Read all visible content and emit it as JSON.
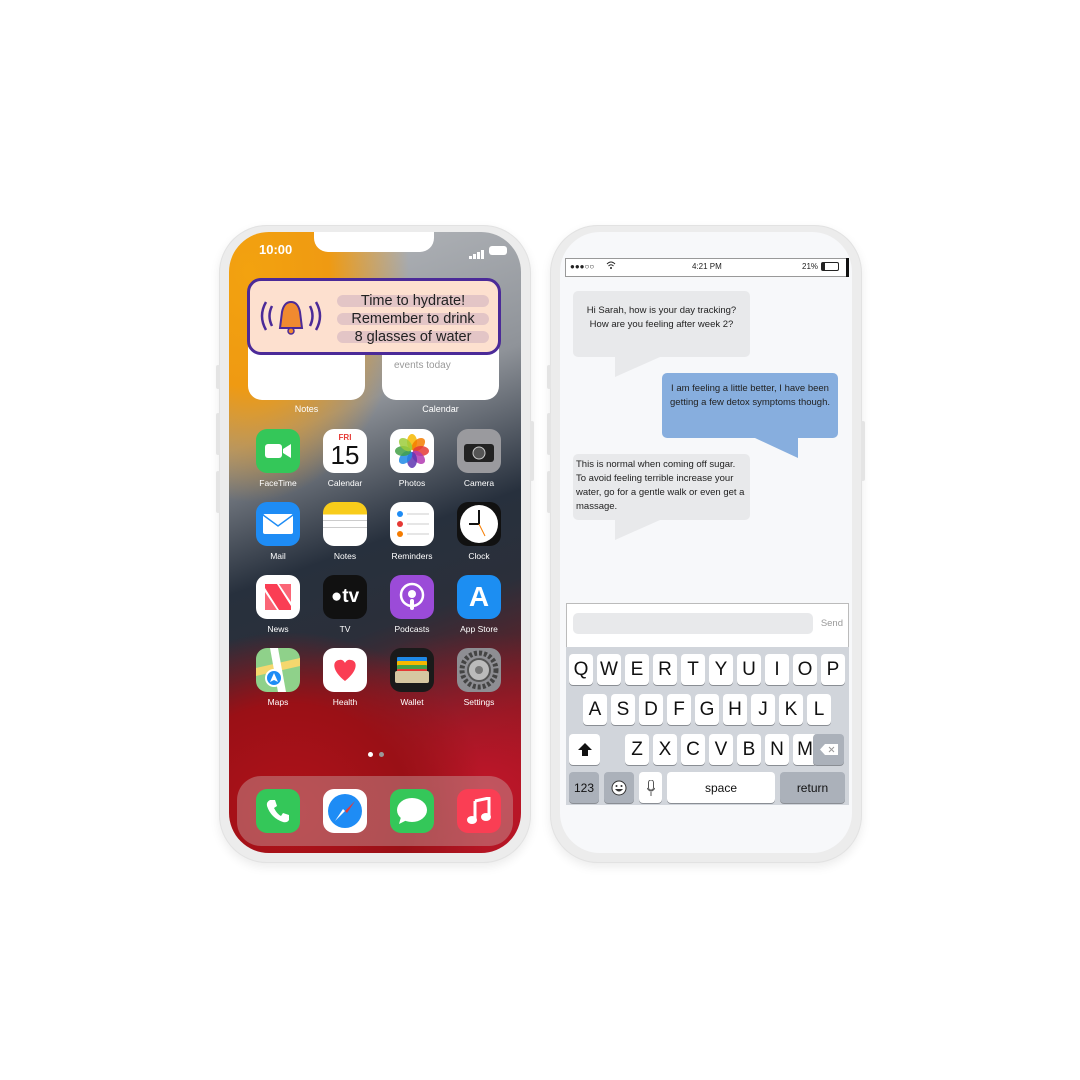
{
  "home_phone": {
    "status_time": "10:00",
    "notification": {
      "icon": "bell-ringing-icon",
      "lines": [
        "Time to hydrate!",
        "Remember to drink",
        "8 glasses of water"
      ],
      "border_color": "#4b2a98",
      "bell_color": "#f08a30",
      "background": "#fde0cf"
    },
    "widgets": [
      {
        "label": "Notes",
        "text": ""
      },
      {
        "label": "Calendar",
        "text": "events today"
      }
    ],
    "apps": [
      {
        "label": "FaceTime",
        "icon": "video-camera-icon",
        "color": "#34c759"
      },
      {
        "label": "Calendar",
        "icon": "calendar-icon",
        "color": "#ffffff",
        "day": "FRI",
        "date": "15"
      },
      {
        "label": "Photos",
        "icon": "photos-flower-icon",
        "color": "#ffffff"
      },
      {
        "label": "Camera",
        "icon": "camera-icon",
        "color": "#9a9a9e"
      },
      {
        "label": "Mail",
        "icon": "envelope-icon",
        "color": "#1e8cf5"
      },
      {
        "label": "Notes",
        "icon": "notepad-icon",
        "color": "#ffffff"
      },
      {
        "label": "Reminders",
        "icon": "list-icon",
        "color": "#ffffff"
      },
      {
        "label": "Clock",
        "icon": "clock-icon",
        "color": "#111111"
      },
      {
        "label": "News",
        "icon": "news-icon",
        "color": "#ffffff"
      },
      {
        "label": "TV",
        "icon": "apple-tv-icon",
        "color": "#111111",
        "glyph": "tv"
      },
      {
        "label": "Podcasts",
        "icon": "podcast-icon",
        "color": "#9b4bd8"
      },
      {
        "label": "App Store",
        "icon": "app-store-icon",
        "color": "#1c8ef2",
        "glyph": "A"
      },
      {
        "label": "Maps",
        "icon": "map-icon",
        "color": "#8fd18a"
      },
      {
        "label": "Health",
        "icon": "heart-icon",
        "color": "#ffffff"
      },
      {
        "label": "Wallet",
        "icon": "wallet-icon",
        "color": "#1a1a1a"
      },
      {
        "label": "Settings",
        "icon": "gear-icon",
        "color": "#8e8e93"
      }
    ],
    "dock": [
      {
        "icon": "phone-icon",
        "color": "#34c759"
      },
      {
        "icon": "safari-compass-icon",
        "color": "#ffffff"
      },
      {
        "icon": "messages-icon",
        "color": "#34c759"
      },
      {
        "icon": "music-note-icon",
        "color": "#fa3e54"
      }
    ],
    "page_count": 2,
    "current_page": 1
  },
  "chat_phone": {
    "status": {
      "signal": "●●●○○",
      "time": "4:21 PM",
      "battery": "21%",
      "battery_level": 0.21
    },
    "messages": [
      {
        "from": "them",
        "text": "Hi Sarah, how is your day tracking? How are you feeling after week 2?"
      },
      {
        "from": "me",
        "text": "I am feeling a little better, I have been getting a few detox symptoms though."
      },
      {
        "from": "them",
        "text": "This is normal when coming off sugar. To avoid feeling terrible increase your water, go for a gentle walk or even get a massage."
      }
    ],
    "colors": {
      "incoming": "#e8e9eb",
      "outgoing": "#87aede"
    },
    "input": {
      "value": "",
      "send_label": "Send"
    },
    "keyboard": {
      "rows": [
        [
          "Q",
          "W",
          "E",
          "R",
          "T",
          "Y",
          "U",
          "I",
          "O",
          "P"
        ],
        [
          "A",
          "S",
          "D",
          "F",
          "G",
          "H",
          "J",
          "K",
          "L"
        ],
        [
          "Z",
          "X",
          "C",
          "V",
          "B",
          "N",
          "M"
        ]
      ],
      "numbers_label": "123",
      "space_label": "space",
      "return_label": "return"
    }
  }
}
